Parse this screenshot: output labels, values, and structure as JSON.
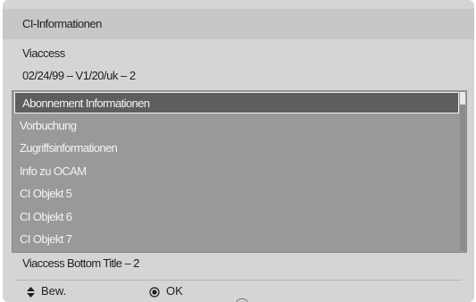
{
  "header": {
    "title": "CI-Informationen"
  },
  "info": {
    "provider": "Viaccess",
    "version": "02/24/99 – V1/20/uk – 2"
  },
  "menu": {
    "items": [
      {
        "label": "Abonnement Informationen",
        "selected": true
      },
      {
        "label": "Vorbuchung",
        "selected": false
      },
      {
        "label": "Zugriffsinformationen",
        "selected": false
      },
      {
        "label": "Info zu OCAM",
        "selected": false
      },
      {
        "label": "CI Objekt 5",
        "selected": false
      },
      {
        "label": "CI Objekt 6",
        "selected": false
      },
      {
        "label": "CI Objekt 7",
        "selected": false
      }
    ]
  },
  "bottom": {
    "title": "Viaccess Bottom Title – 2"
  },
  "footer": {
    "move_label": "Bew.",
    "move_icon": "updown-arrows-icon",
    "ok_label": "OK",
    "ok_icon": "ok-button-icon"
  },
  "colors": {
    "background": "#d5d5d5",
    "list_background": "#999999",
    "selected_row": "#5e5e5e",
    "text_dark": "#1e1e1e",
    "text_light": "#f4f4f4"
  }
}
